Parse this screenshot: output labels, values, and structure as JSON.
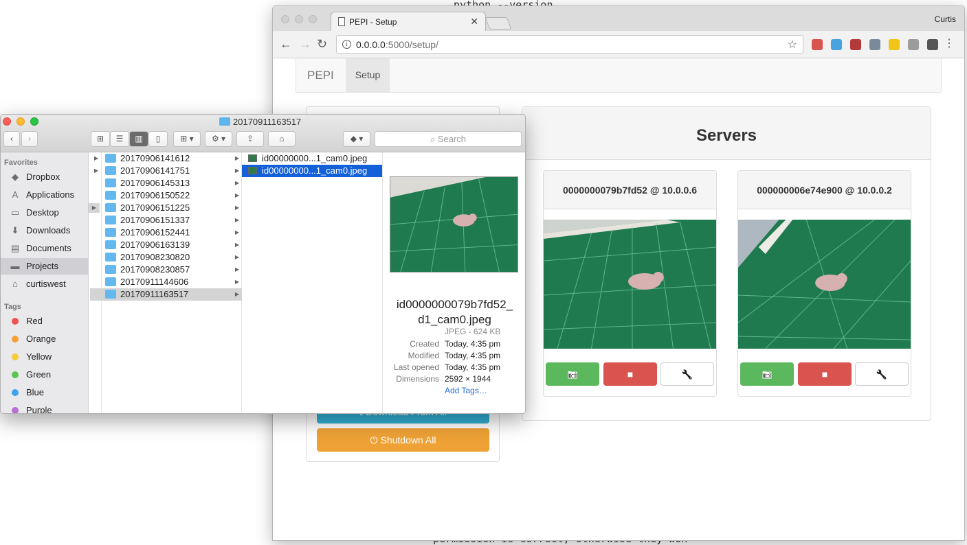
{
  "background_terminal": {
    "top_line": "python --version",
    "bottom_line": "permission is correct, otherwise they won"
  },
  "chrome": {
    "tab_title": "PEPI - Setup",
    "tab_close": "✕",
    "profile_name": "Curtis",
    "url_host": "0.0.0.0",
    "url_path": ":5000/setup/",
    "nav": {
      "back": "←",
      "forward": "→",
      "reload": "↻",
      "star": "☆",
      "menu": "⋮",
      "info": "i"
    },
    "extension_colors": [
      "#d9534f",
      "#4aa3df",
      "#b33a3a",
      "#7a8a9a",
      "#f0c419",
      "#9c9c9c",
      "#555555"
    ]
  },
  "pepi": {
    "brand": "PEPI",
    "nav_setup": "Setup",
    "download_all": "⭳ Download From All",
    "shutdown_all": "⏻ Shutdown All",
    "servers_title": "Servers",
    "servers": [
      {
        "title": "0000000079b7fd52 @ 10.0.0.6",
        "capture_icon": "📷",
        "record_icon": "■",
        "settings_icon": "🔧"
      },
      {
        "title": "000000006e74e900 @ 10.0.0.2",
        "capture_icon": "📷",
        "record_icon": "■",
        "settings_icon": "🔧"
      }
    ]
  },
  "finder": {
    "window_title": "20170911163517",
    "search_placeholder": "Search",
    "toolbar": {
      "back": "‹",
      "forward": "›",
      "view_icons": "⊞",
      "view_list": "☰",
      "view_columns": "▥",
      "view_gallery": "▯",
      "arrange": "⊞ ▾",
      "action": "⚙ ▾",
      "share": "⇪",
      "tag": "⌂",
      "dropbox": "◆ ▾"
    },
    "sidebar": {
      "favorites_header": "Favorites",
      "favorites": [
        {
          "label": "Dropbox",
          "icon": "◆"
        },
        {
          "label": "Applications",
          "icon": "A"
        },
        {
          "label": "Desktop",
          "icon": "▭"
        },
        {
          "label": "Downloads",
          "icon": "⬇"
        },
        {
          "label": "Documents",
          "icon": "▤"
        },
        {
          "label": "Projects",
          "icon": "▬"
        },
        {
          "label": "curtiswest",
          "icon": "⌂"
        }
      ],
      "tags_header": "Tags",
      "tags": [
        {
          "label": "Red",
          "color": "#f0524f"
        },
        {
          "label": "Orange",
          "color": "#f6a035"
        },
        {
          "label": "Yellow",
          "color": "#f5cb37"
        },
        {
          "label": "Green",
          "color": "#5ac54e"
        },
        {
          "label": "Blue",
          "color": "#3da3f0"
        },
        {
          "label": "Purple",
          "color": "#b86ed6"
        }
      ]
    },
    "folders": [
      "20170906141612",
      "20170906141751",
      "20170906145313",
      "20170906150522",
      "20170906151225",
      "20170906151337",
      "20170906152441",
      "20170906163139",
      "20170908230820",
      "20170908230857",
      "20170911144606",
      "20170911163517"
    ],
    "files": [
      "id00000000...1_cam0.jpeg",
      "id00000000...1_cam0.jpeg"
    ],
    "preview": {
      "filename_line1": "id0000000079b7fd52_",
      "filename_line2": "d1_cam0.jpeg",
      "kind": "JPEG - 624 KB",
      "created_label": "Created",
      "created_value": "Today, 4:35 pm",
      "modified_label": "Modified",
      "modified_value": "Today, 4:35 pm",
      "opened_label": "Last opened",
      "opened_value": "Today, 4:35 pm",
      "dimensions_label": "Dimensions",
      "dimensions_value": "2592 × 1944",
      "add_tags": "Add Tags…"
    }
  }
}
